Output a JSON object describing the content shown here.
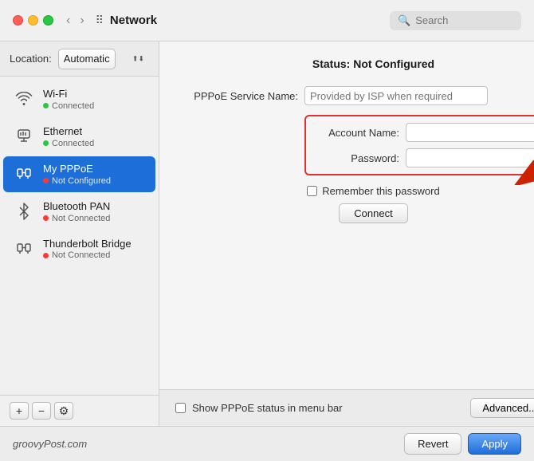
{
  "titleBar": {
    "title": "Network",
    "searchPlaceholder": "Search"
  },
  "location": {
    "label": "Location:",
    "value": "Automatic"
  },
  "sidebar": {
    "items": [
      {
        "id": "wifi",
        "name": "Wi-Fi",
        "status": "Connected",
        "statusType": "green",
        "icon": "wifi"
      },
      {
        "id": "ethernet",
        "name": "Ethernet",
        "status": "Connected",
        "statusType": "green",
        "icon": "ethernet"
      },
      {
        "id": "pppoe",
        "name": "My PPPoE",
        "status": "Not Configured",
        "statusType": "red",
        "icon": "pppoe",
        "active": true
      },
      {
        "id": "bluetooth-pan",
        "name": "Bluetooth PAN",
        "status": "Not Connected",
        "statusType": "red",
        "icon": "bluetooth"
      },
      {
        "id": "thunderbolt",
        "name": "Thunderbolt Bridge",
        "status": "Not Connected",
        "statusType": "red",
        "icon": "thunderbolt"
      }
    ],
    "addLabel": "+",
    "removeLabel": "−",
    "settingsLabel": "⚙"
  },
  "panel": {
    "statusLabel": "Status:",
    "statusValue": "Not Configured",
    "pppoeServiceLabel": "PPPoE Service Name:",
    "pppoeServicePlaceholder": "Provided by ISP when required",
    "accountNameLabel": "Account Name:",
    "passwordLabel": "Password:",
    "rememberPasswordLabel": "Remember this password",
    "connectLabel": "Connect",
    "showMenuBarLabel": "Show PPPoE status in menu bar",
    "advancedLabel": "Advanced...",
    "helpLabel": "?"
  },
  "footer": {
    "branding": "groovyPost.com",
    "revertLabel": "Revert",
    "applyLabel": "Apply"
  }
}
